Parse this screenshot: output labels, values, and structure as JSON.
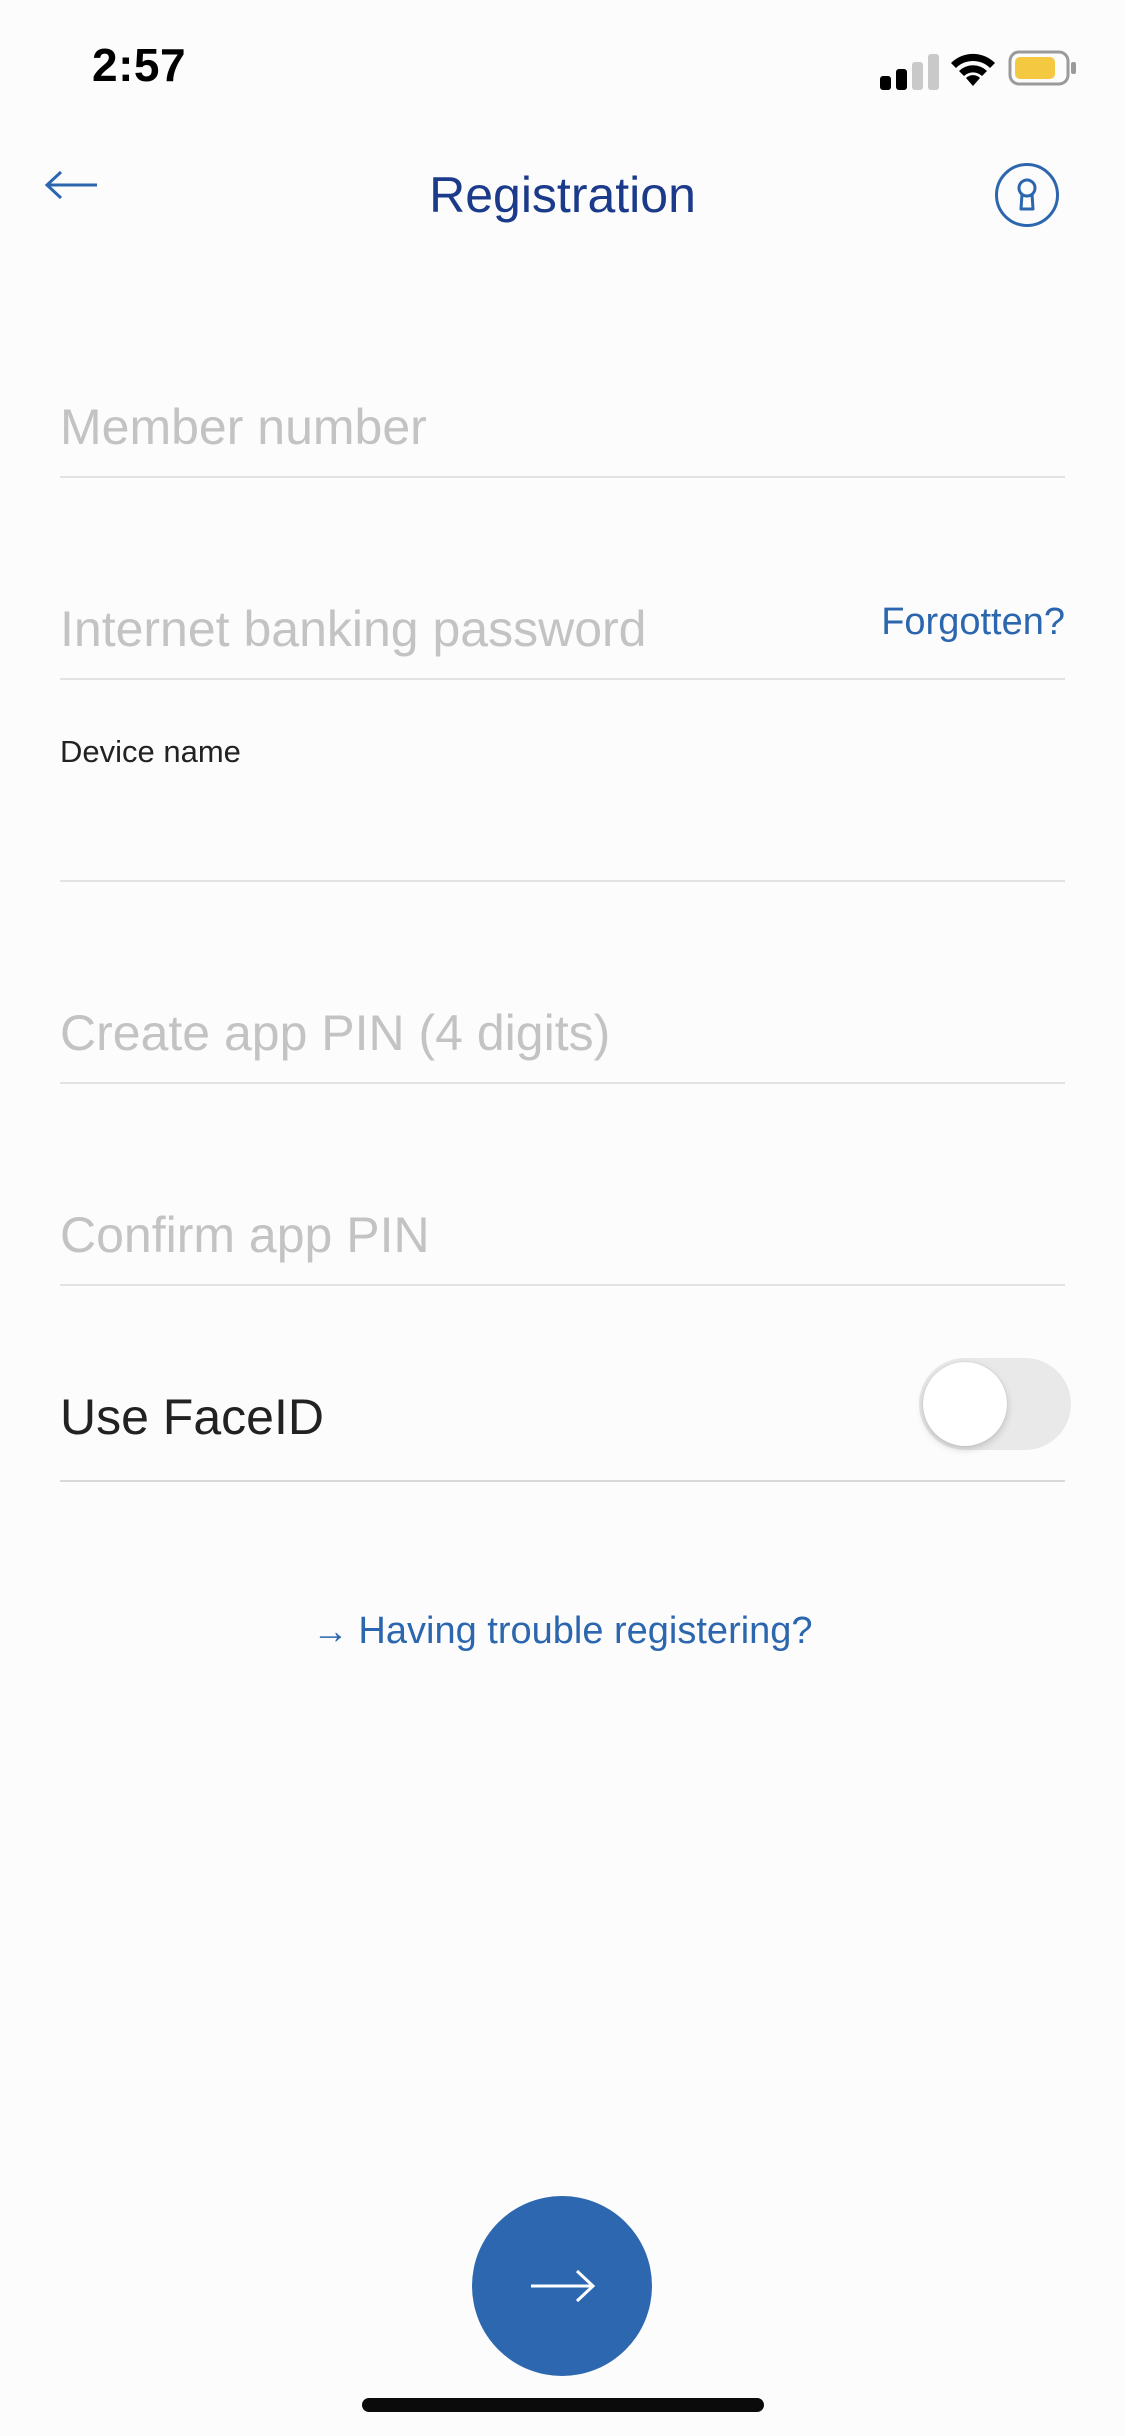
{
  "status_bar": {
    "time": "2:57"
  },
  "nav": {
    "title": "Registration",
    "back_icon": "arrow-left-icon",
    "key_icon": "keyhole-icon"
  },
  "form": {
    "member_number": {
      "placeholder": "Member number",
      "value": ""
    },
    "password": {
      "placeholder": "Internet banking password",
      "value": "",
      "forgot_label": "Forgotten?"
    },
    "device_name": {
      "label": "Device name",
      "value": ""
    },
    "create_pin": {
      "placeholder": "Create app PIN (4 digits)",
      "value": ""
    },
    "confirm_pin": {
      "placeholder": "Confirm app PIN",
      "value": ""
    },
    "faceid": {
      "label": "Use FaceID",
      "enabled": false
    }
  },
  "help": {
    "link_label": "Having trouble registering?"
  },
  "colors": {
    "accent": "#2c67b0",
    "title": "#1b3a8a",
    "battery": "#f5c842"
  }
}
